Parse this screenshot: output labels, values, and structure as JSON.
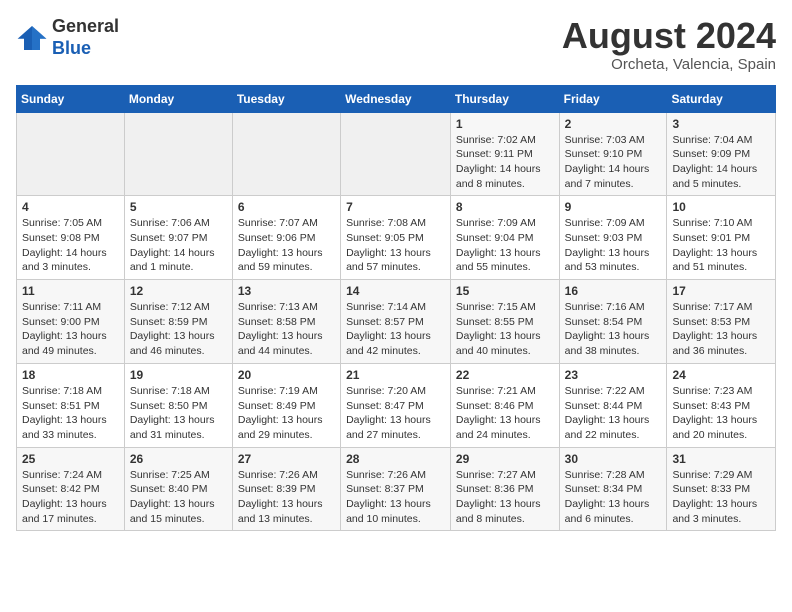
{
  "header": {
    "logo_line1": "General",
    "logo_line2": "Blue",
    "month_title": "August 2024",
    "location": "Orcheta, Valencia, Spain"
  },
  "days_of_week": [
    "Sunday",
    "Monday",
    "Tuesday",
    "Wednesday",
    "Thursday",
    "Friday",
    "Saturday"
  ],
  "weeks": [
    [
      {
        "day": "",
        "info": ""
      },
      {
        "day": "",
        "info": ""
      },
      {
        "day": "",
        "info": ""
      },
      {
        "day": "",
        "info": ""
      },
      {
        "day": "1",
        "info": "Sunrise: 7:02 AM\nSunset: 9:11 PM\nDaylight: 14 hours and 8 minutes."
      },
      {
        "day": "2",
        "info": "Sunrise: 7:03 AM\nSunset: 9:10 PM\nDaylight: 14 hours and 7 minutes."
      },
      {
        "day": "3",
        "info": "Sunrise: 7:04 AM\nSunset: 9:09 PM\nDaylight: 14 hours and 5 minutes."
      }
    ],
    [
      {
        "day": "4",
        "info": "Sunrise: 7:05 AM\nSunset: 9:08 PM\nDaylight: 14 hours and 3 minutes."
      },
      {
        "day": "5",
        "info": "Sunrise: 7:06 AM\nSunset: 9:07 PM\nDaylight: 14 hours and 1 minute."
      },
      {
        "day": "6",
        "info": "Sunrise: 7:07 AM\nSunset: 9:06 PM\nDaylight: 13 hours and 59 minutes."
      },
      {
        "day": "7",
        "info": "Sunrise: 7:08 AM\nSunset: 9:05 PM\nDaylight: 13 hours and 57 minutes."
      },
      {
        "day": "8",
        "info": "Sunrise: 7:09 AM\nSunset: 9:04 PM\nDaylight: 13 hours and 55 minutes."
      },
      {
        "day": "9",
        "info": "Sunrise: 7:09 AM\nSunset: 9:03 PM\nDaylight: 13 hours and 53 minutes."
      },
      {
        "day": "10",
        "info": "Sunrise: 7:10 AM\nSunset: 9:01 PM\nDaylight: 13 hours and 51 minutes."
      }
    ],
    [
      {
        "day": "11",
        "info": "Sunrise: 7:11 AM\nSunset: 9:00 PM\nDaylight: 13 hours and 49 minutes."
      },
      {
        "day": "12",
        "info": "Sunrise: 7:12 AM\nSunset: 8:59 PM\nDaylight: 13 hours and 46 minutes."
      },
      {
        "day": "13",
        "info": "Sunrise: 7:13 AM\nSunset: 8:58 PM\nDaylight: 13 hours and 44 minutes."
      },
      {
        "day": "14",
        "info": "Sunrise: 7:14 AM\nSunset: 8:57 PM\nDaylight: 13 hours and 42 minutes."
      },
      {
        "day": "15",
        "info": "Sunrise: 7:15 AM\nSunset: 8:55 PM\nDaylight: 13 hours and 40 minutes."
      },
      {
        "day": "16",
        "info": "Sunrise: 7:16 AM\nSunset: 8:54 PM\nDaylight: 13 hours and 38 minutes."
      },
      {
        "day": "17",
        "info": "Sunrise: 7:17 AM\nSunset: 8:53 PM\nDaylight: 13 hours and 36 minutes."
      }
    ],
    [
      {
        "day": "18",
        "info": "Sunrise: 7:18 AM\nSunset: 8:51 PM\nDaylight: 13 hours and 33 minutes."
      },
      {
        "day": "19",
        "info": "Sunrise: 7:18 AM\nSunset: 8:50 PM\nDaylight: 13 hours and 31 minutes."
      },
      {
        "day": "20",
        "info": "Sunrise: 7:19 AM\nSunset: 8:49 PM\nDaylight: 13 hours and 29 minutes."
      },
      {
        "day": "21",
        "info": "Sunrise: 7:20 AM\nSunset: 8:47 PM\nDaylight: 13 hours and 27 minutes."
      },
      {
        "day": "22",
        "info": "Sunrise: 7:21 AM\nSunset: 8:46 PM\nDaylight: 13 hours and 24 minutes."
      },
      {
        "day": "23",
        "info": "Sunrise: 7:22 AM\nSunset: 8:44 PM\nDaylight: 13 hours and 22 minutes."
      },
      {
        "day": "24",
        "info": "Sunrise: 7:23 AM\nSunset: 8:43 PM\nDaylight: 13 hours and 20 minutes."
      }
    ],
    [
      {
        "day": "25",
        "info": "Sunrise: 7:24 AM\nSunset: 8:42 PM\nDaylight: 13 hours and 17 minutes."
      },
      {
        "day": "26",
        "info": "Sunrise: 7:25 AM\nSunset: 8:40 PM\nDaylight: 13 hours and 15 minutes."
      },
      {
        "day": "27",
        "info": "Sunrise: 7:26 AM\nSunset: 8:39 PM\nDaylight: 13 hours and 13 minutes."
      },
      {
        "day": "28",
        "info": "Sunrise: 7:26 AM\nSunset: 8:37 PM\nDaylight: 13 hours and 10 minutes."
      },
      {
        "day": "29",
        "info": "Sunrise: 7:27 AM\nSunset: 8:36 PM\nDaylight: 13 hours and 8 minutes."
      },
      {
        "day": "30",
        "info": "Sunrise: 7:28 AM\nSunset: 8:34 PM\nDaylight: 13 hours and 6 minutes."
      },
      {
        "day": "31",
        "info": "Sunrise: 7:29 AM\nSunset: 8:33 PM\nDaylight: 13 hours and 3 minutes."
      }
    ]
  ]
}
